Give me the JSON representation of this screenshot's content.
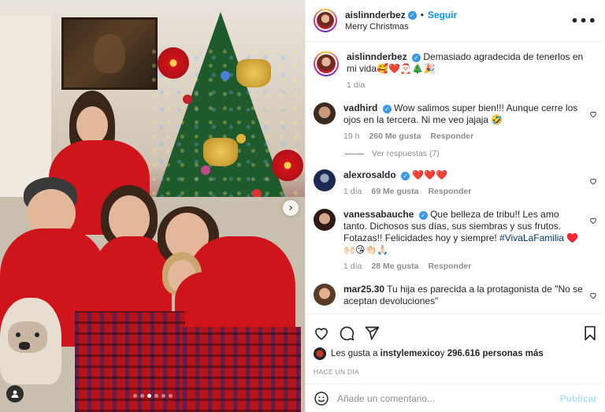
{
  "post": {
    "author": "aislinnderbez",
    "follow_label": "Seguir",
    "location": "Merry Christmas",
    "more_label": "•••",
    "caption": {
      "username": "aislinnderbez",
      "text": "Demasiado agradecida de tenerlos en mi vida🥰❤️🎅🏻🎄🎉",
      "time": "1 día"
    }
  },
  "comments": [
    {
      "username": "vadhird",
      "verified": true,
      "text": "Wow salimos super bien!!! Aunque cerre los ojos en la tercera. Ni me veo jajaja 🤣",
      "time": "19 h",
      "likes": "260 Me gusta",
      "reply_label": "Responder",
      "view_replies": "Ver respuestas (7)"
    },
    {
      "username": "alexrosaldo",
      "verified": true,
      "text": "❤️❤️❤️",
      "time": "1 día",
      "likes": "69 Me gusta",
      "reply_label": "Responder"
    },
    {
      "username": "vanessabauche",
      "verified": true,
      "text": "Que belleza de tribu!! Les amo tanto. Dichosos sus días, sus siembras y sus frutos. Fotazas!! Felicidades hoy y siempre!",
      "hashtag": "#VivaLaFamilia",
      "text_end": " ♥️🙌🏻😘👏🏻🙏🏻",
      "time": "1 día",
      "likes": "28 Me gusta",
      "reply_label": "Responder"
    },
    {
      "username": "mar25.30",
      "verified": false,
      "text": "Tu hija es parecida a la protagonista de \"No se aceptan devoluciones\""
    }
  ],
  "likes": {
    "prefix": "Les gusta a ",
    "user": "instylemexico",
    "middle": " y ",
    "count": "296.616 personas más"
  },
  "posted": "HACE UN DÍA",
  "composer": {
    "placeholder": "Añade un comentario...",
    "publish_label": "Publicar"
  },
  "icons": {
    "like": "heart-icon",
    "comment": "comment-icon",
    "share": "paper-plane-icon",
    "save": "bookmark-icon",
    "emoji": "emoji-icon",
    "tag": "user-tag-icon",
    "next": "chevron-right-icon",
    "more": "more-options-icon",
    "verified": "verified-badge-icon"
  },
  "colors": {
    "accent": "#0095f6",
    "verified": "#3897f0",
    "publish_disabled": "#b2dffc",
    "secondary_text": "#8e8e8e"
  },
  "carousel": {
    "current": 3,
    "total": 6
  }
}
